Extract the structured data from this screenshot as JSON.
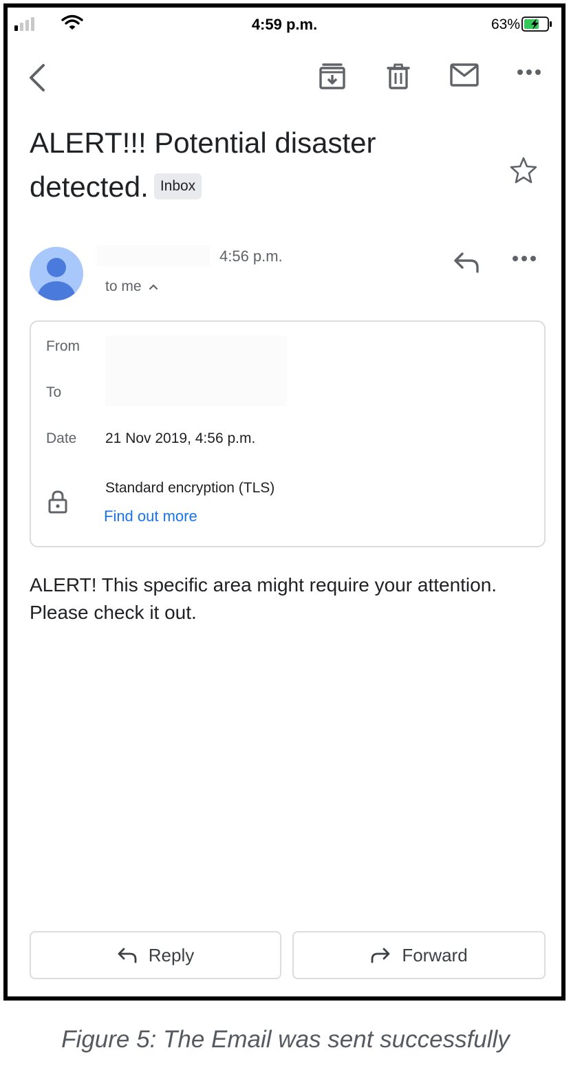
{
  "status_bar": {
    "time": "4:59 p.m.",
    "battery_percent": "63%",
    "signal_bars_active": 1,
    "signal_bars_total": 4,
    "battery_charging": true,
    "battery_level": 0.63
  },
  "toolbar": {
    "icons": [
      "back-icon",
      "archive-icon",
      "delete-icon",
      "mark-unread-icon",
      "more-icon"
    ]
  },
  "email": {
    "subject": "ALERT!!! Potential disaster detected.",
    "label": "Inbox",
    "sent_time": "4:56 p.m.",
    "recipient_summary": "to me",
    "details": {
      "from_label": "From",
      "to_label": "To",
      "date_label": "Date",
      "date_value": "21 Nov 2019, 4:56 p.m.",
      "encryption": "Standard encryption (TLS)",
      "find_out_more": "Find out more"
    },
    "body": "ALERT! This specific area might require your attention. Please check it out."
  },
  "actions": {
    "reply_label": "Reply",
    "forward_label": "Forward"
  },
  "caption": "Figure 5: The Email was sent successfully",
  "colors": {
    "link": "#1a73e8",
    "avatar_bg": "#a8c7fa",
    "avatar_fg": "#4a7bdc",
    "badge_bg": "#e8eaed",
    "battery_fill": "#34c759"
  }
}
